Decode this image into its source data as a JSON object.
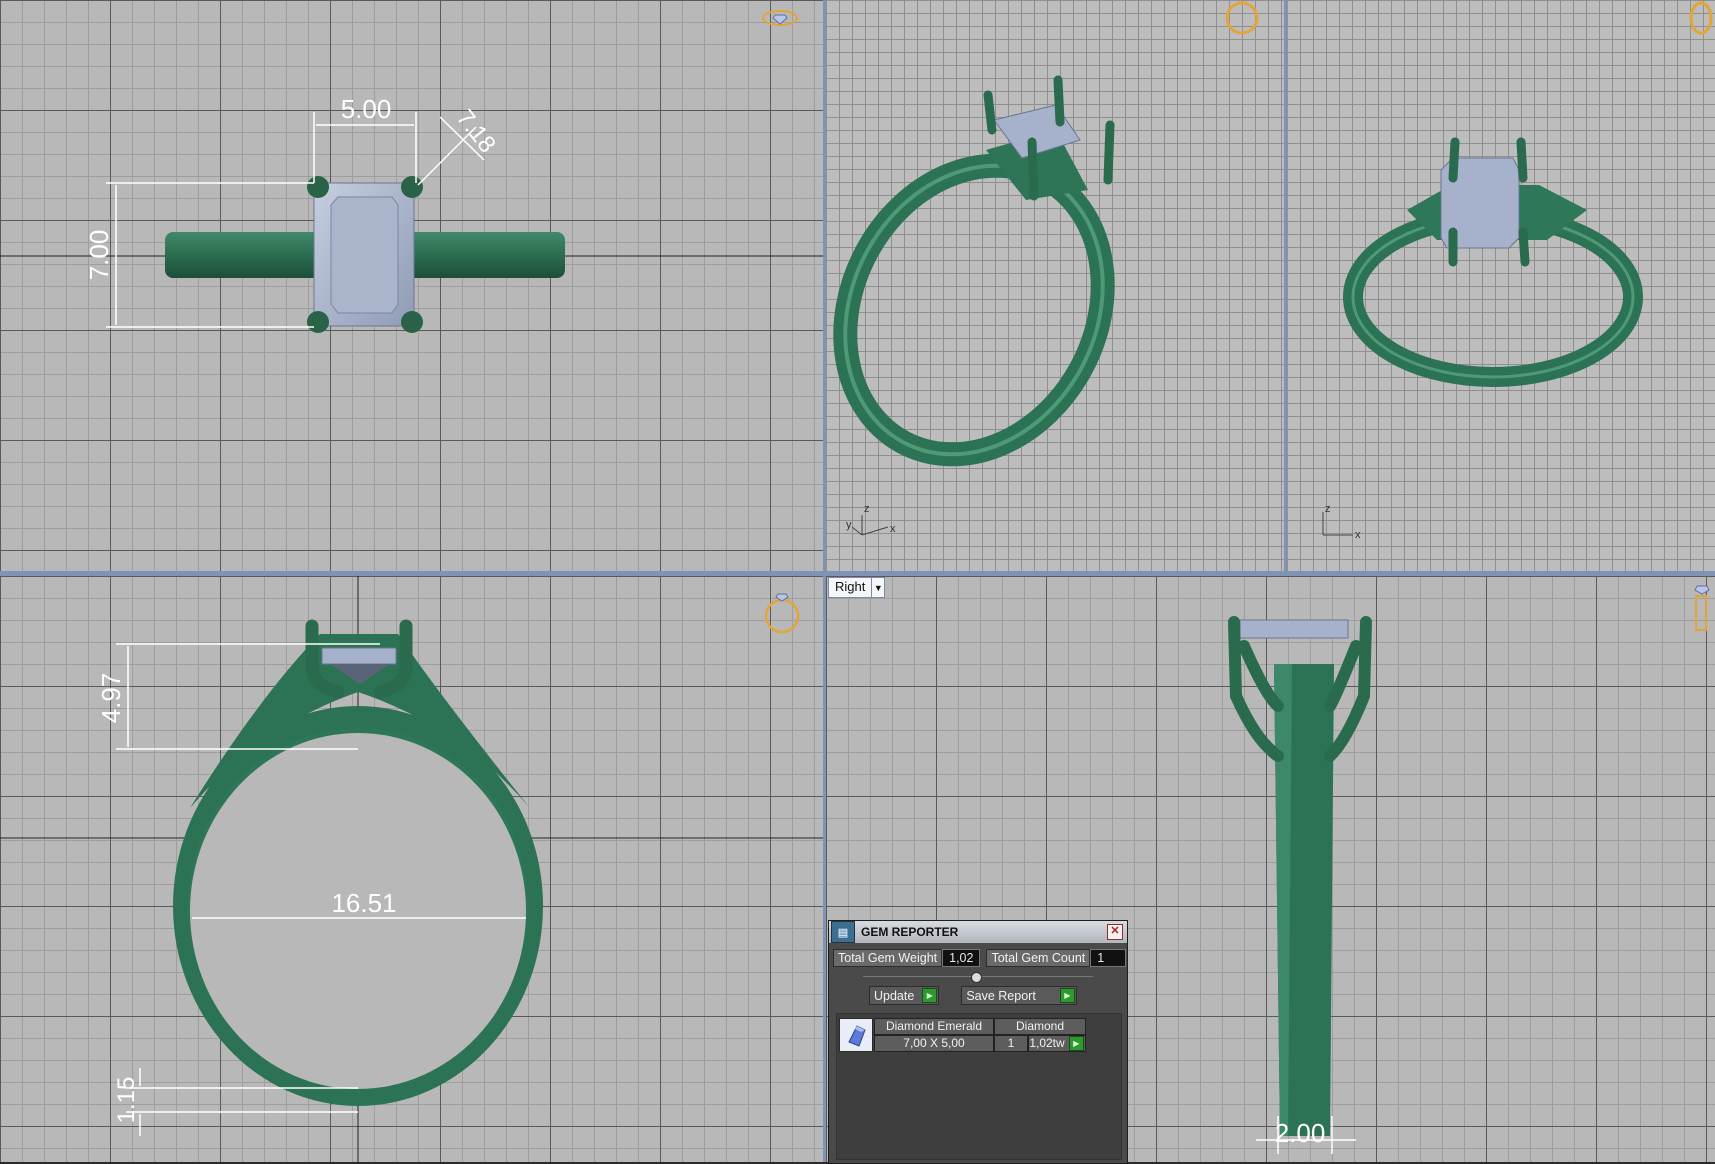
{
  "viewports": {
    "top": {
      "dimensions": [
        "5.00",
        "7.18",
        "7.00"
      ]
    },
    "front": {
      "dimensions": [
        "4.97",
        "16.51",
        "1.15"
      ]
    },
    "right": {
      "view_selector": "Right",
      "dimensions": [
        "2.00"
      ]
    },
    "perspective_axes": {
      "z": "z",
      "y": "y",
      "x": "x"
    }
  },
  "gem_reporter": {
    "title": "GEM REPORTER",
    "total_gem_weight_label": "Total Gem Weight",
    "total_gem_weight": "1,02",
    "total_gem_count_label": "Total Gem Count",
    "total_gem_count": "1",
    "update_label": "Update",
    "save_report_label": "Save Report",
    "gems": [
      {
        "cut": "Diamond Emerald",
        "material": "Diamond",
        "size": "7,00 X 5,00",
        "count": "1",
        "weight": "1,02tw"
      }
    ]
  },
  "colors": {
    "metal": "#2f7a5a",
    "gem": "#a8b4cc",
    "dim_line": "#ffffff",
    "viewport_border": "#7f93b5"
  }
}
